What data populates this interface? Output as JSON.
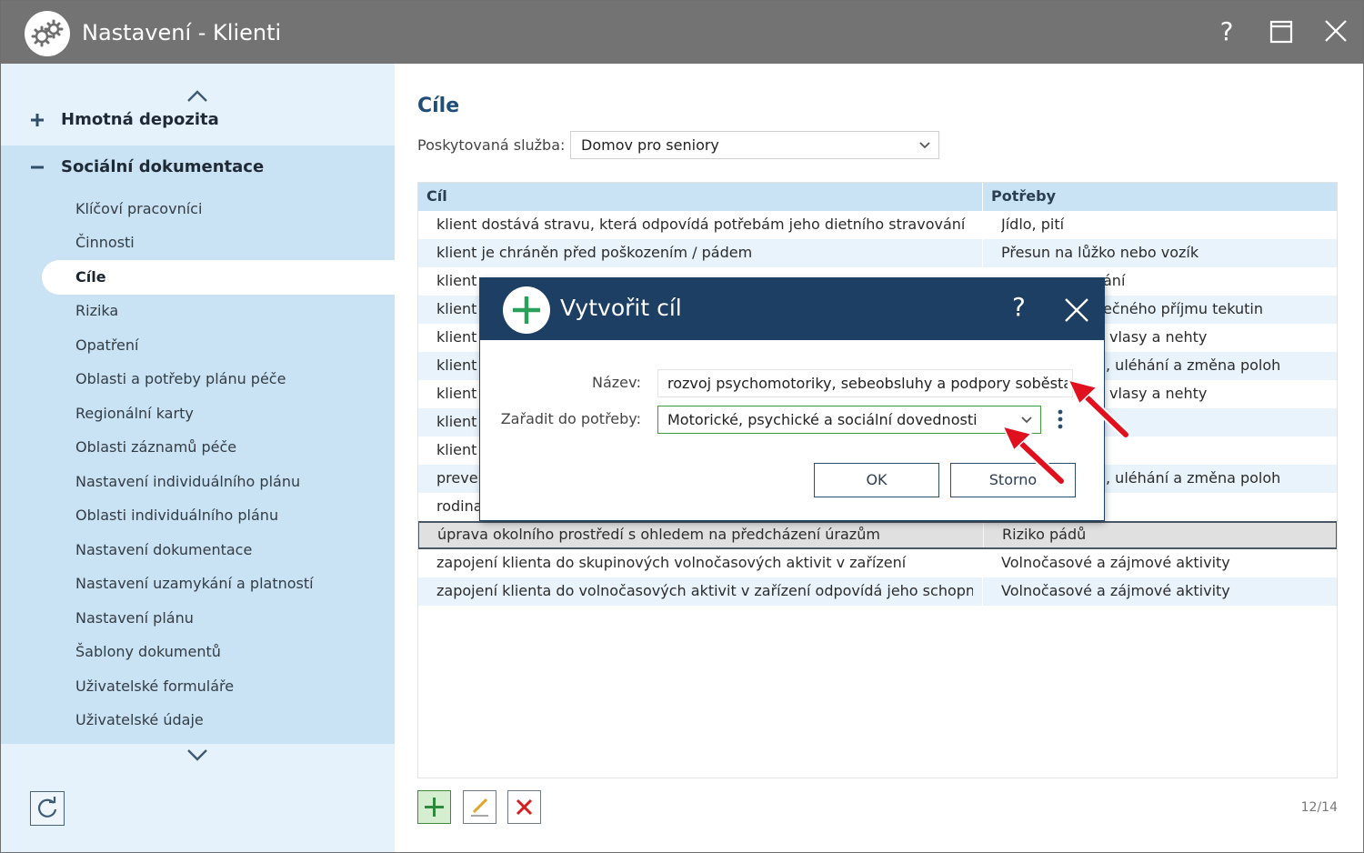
{
  "window": {
    "title": "Nastavení - Klienti",
    "help_label": "?"
  },
  "sidebar": {
    "groups": [
      {
        "label": "Hmotná depozita",
        "state": "collapsed"
      },
      {
        "label": "Sociální dokumentace",
        "state": "expanded"
      }
    ],
    "items": [
      {
        "label": "Klíčoví pracovníci"
      },
      {
        "label": "Činnosti"
      },
      {
        "label": "Cíle",
        "active": true
      },
      {
        "label": "Rizika"
      },
      {
        "label": "Opatření"
      },
      {
        "label": "Oblasti a potřeby plánu péče"
      },
      {
        "label": "Regionální karty"
      },
      {
        "label": "Oblasti záznamů péče"
      },
      {
        "label": "Nastavení individuálního plánu"
      },
      {
        "label": "Oblasti individuálního plánu"
      },
      {
        "label": "Nastavení dokumentace"
      },
      {
        "label": "Nastavení uzamykání a platností"
      },
      {
        "label": "Nastavení plánu"
      },
      {
        "label": "Šablony dokumentů"
      },
      {
        "label": "Uživatelské formuláře"
      },
      {
        "label": "Uživatelské údaje"
      }
    ]
  },
  "main": {
    "title": "Cíle",
    "service_label": "Poskytovaná služba:",
    "service_value": "Domov pro seniory",
    "columns": [
      "Cíl",
      "Potřeby"
    ],
    "rows": [
      {
        "cil": "klient dostává stravu, která odpovídá potřebám jeho dietního stravování",
        "potreby": "Jídlo, pití"
      },
      {
        "cil": "klient je chráněn před poškozením / pádem",
        "potreby": "Přesun na lůžko nebo vozík"
      },
      {
        "cil": "klient",
        "potreby": "ání"
      },
      {
        "cil": "klient",
        "potreby": "ečného příjmu tekutin"
      },
      {
        "cil": "klient",
        "potreby": "vlasy a nehty"
      },
      {
        "cil": "klient",
        "potreby": ", uléhání a změna poloh"
      },
      {
        "cil": "klient",
        "potreby": "vlasy a nehty"
      },
      {
        "cil": "klient",
        "potreby": ""
      },
      {
        "cil": "klient",
        "potreby": ""
      },
      {
        "cil": "preven",
        "potreby": ", uléhání a změna poloh"
      },
      {
        "cil": "rodina",
        "potreby": ""
      },
      {
        "cil": "úprava okolního prostředí s ohledem na předcházení úrazům",
        "potreby": "Riziko pádů",
        "selected": true
      },
      {
        "cil": "zapojení klienta do skupinových volnočasových aktivit v zařízení",
        "potreby": "Volnočasové a zájmové aktivity"
      },
      {
        "cil": "zapojení klienta do volnočasových aktivit v zařízení odpovídá jeho schopnos...",
        "potreby": "Volnočasové a zájmové aktivity"
      }
    ],
    "pager": "12/14"
  },
  "dialog": {
    "title": "Vytvořit cíl",
    "help_label": "?",
    "name_label": "Název:",
    "name_value": "rozvoj psychomotoriky, sebeobsluhy a podpory soběstačn",
    "category_label": "Zařadit do potřeby:",
    "category_value": "Motorické, psychické a sociální dovednosti",
    "ok_label": "OK",
    "cancel_label": "Storno"
  },
  "colors": {
    "titlebar": "#737373",
    "sidebar_bg": "#e6f2fb",
    "sidebar_list": "#c9e3f4",
    "dialog_header": "#1c3f63",
    "accent_green": "#2aa05a",
    "annotation_red": "#e0101e"
  },
  "icons": {
    "app": "gears-icon",
    "help": "question-icon",
    "maximize": "maximize-icon",
    "close": "close-icon",
    "refresh": "refresh-icon",
    "add": "plus-icon",
    "edit": "pencil-icon",
    "delete": "delete-x-icon"
  }
}
